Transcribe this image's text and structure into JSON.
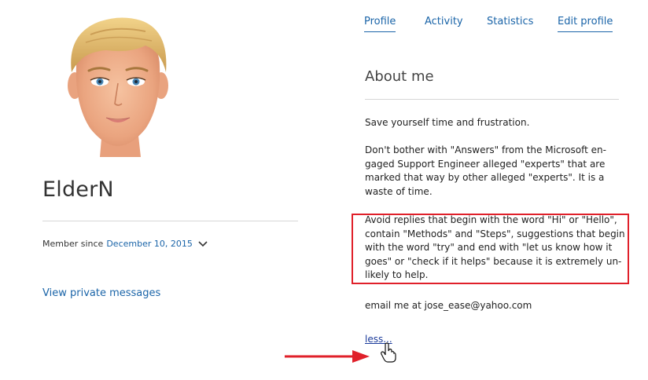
{
  "profile": {
    "name": "ElderN",
    "member_since_label": "Member since",
    "member_since_date": "December 10, 2015",
    "private_messages_label": "View private messages"
  },
  "tabs": [
    {
      "label": "Profile",
      "active": true
    },
    {
      "label": "Activity",
      "active": false
    },
    {
      "label": "Statistics",
      "active": false
    },
    {
      "label": "Edit profile",
      "active": false
    }
  ],
  "about": {
    "title": "About me",
    "paragraph1": "Save yourself time and frustration.",
    "paragraph2": "Don't bother with \"Answers\" from the Microsoft en-gaged Support Engineer alleged \"experts\" that are marked that way by other alleged \"experts\". It is a waste of time.",
    "paragraph3": "Avoid replies that begin with the word \"Hi\" or \"Hello\", contain \"Methods\" and \"Steps\", suggestions that begin with the word \"try\" and end with \"let us know how it goes\" or \"check if it helps\" because it is extremely un-likely to help.",
    "email_line": "email me at jose_ease@yahoo.com",
    "less_label": "less..."
  },
  "colors": {
    "link": "#1a64a8",
    "highlight": "#e0202a",
    "divider": "#d6d6d6"
  },
  "icons": {
    "avatar": "avatar-face",
    "chevron": "chevron-down-icon",
    "arrow": "red-arrow-annotation",
    "cursor": "hand-pointer-cursor"
  }
}
